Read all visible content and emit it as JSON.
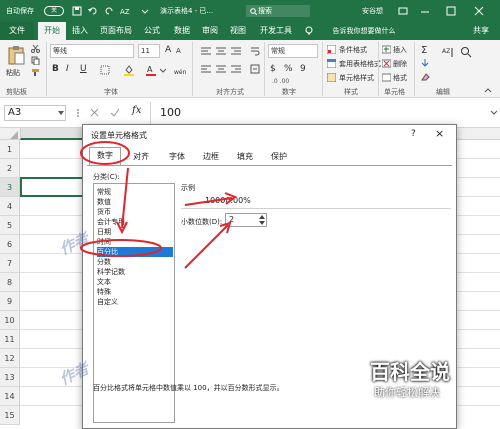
{
  "titlebar": {
    "autosave": "自动保存",
    "autosave_state": "关",
    "doc_title": "演示表格4 - 已...",
    "search_placeholder": "搜索",
    "user": "安谷想",
    "bg_color": "#217346"
  },
  "tabs": [
    "文件",
    "开始",
    "插入",
    "页面布局",
    "公式",
    "数据",
    "审阅",
    "视图",
    "开发工具"
  ],
  "tell_me": "告诉我你想要做什么",
  "share": "共享",
  "ribbon": {
    "paste": "粘贴",
    "font_name": "等线",
    "font_size": "11",
    "bold": "B",
    "italic": "I",
    "underline": "U",
    "grow": "A",
    "shrink": "A",
    "number_format": "常规",
    "currency": "$",
    "percent": "%",
    "comma": "9",
    "cond_format": "条件格式",
    "table_format": "套用表格格式",
    "cell_style": "单元格样式",
    "insert": "插入",
    "delete": "删除",
    "format": "格式",
    "groups": [
      "剪贴板",
      "字体",
      "对齐方式",
      "数字",
      "样式",
      "单元格",
      "编辑"
    ]
  },
  "formula_bar": {
    "name_box": "A3",
    "fx": "fx",
    "value": "100"
  },
  "grid": {
    "rows": [
      "1",
      "2",
      "3",
      "4",
      "5",
      "6",
      "7",
      "8",
      "9",
      "10",
      "11",
      "12",
      "13",
      "14",
      "15"
    ]
  },
  "dialog": {
    "title": "设置单元格格式",
    "help": "?",
    "close": "×",
    "tabs": [
      "数字",
      "对齐",
      "字体",
      "边框",
      "填充",
      "保护"
    ],
    "category_label": "分类(C):",
    "categories": [
      "常规",
      "数值",
      "货币",
      "会计专用",
      "日期",
      "时间",
      "百分比",
      "分数",
      "科学记数",
      "文本",
      "特殊",
      "自定义"
    ],
    "selected_category": "百分比",
    "sample_label": "示例",
    "sample_value": "10000.00%",
    "decimal_label": "小数位数(D):",
    "decimal_value": "2",
    "description": "百分比格式将单元格中数值乘以 100，并以百分数形式显示。",
    "watermark": "作者"
  },
  "brand": {
    "title": "百科全说",
    "subtitle": "助你轻松解决"
  },
  "annotation_color": "#e0262b"
}
